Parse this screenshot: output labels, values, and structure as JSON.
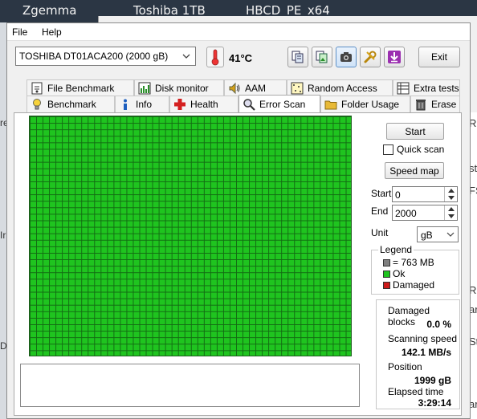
{
  "desktop": {
    "taskbar_items": [
      "Zgemma",
      "Toshiba 1TB",
      "HBCD_PE_x64"
    ],
    "right_edge_letters": [
      "R",
      "st",
      "FS",
      "R",
      "ar",
      "St",
      "ar"
    ],
    "left_edge_letters": [
      "re",
      "Ir",
      "D"
    ]
  },
  "menu": {
    "file": "File",
    "help": "Help"
  },
  "toolbar": {
    "drive": "TOSHIBA DT01ACA200 (2000 gB)",
    "temperature": "41°C",
    "exit_label": "Exit"
  },
  "tabs": {
    "row1": [
      "File Benchmark",
      "Disk monitor",
      "AAM",
      "Random Access",
      "Extra tests"
    ],
    "row2": [
      "Benchmark",
      "Info",
      "Health",
      "Error Scan",
      "Folder Usage",
      "Erase"
    ],
    "selected": "Error Scan"
  },
  "error_scan": {
    "start_button": "Start",
    "quick_scan_label": "Quick scan",
    "quick_scan_checked": false,
    "speed_map_button": "Speed map",
    "start_label": "Start",
    "start_value": "0",
    "end_label": "End",
    "end_value": "2000",
    "unit_label": "Unit",
    "unit_value": "gB",
    "legend_title": "Legend",
    "legend_block": "= 763 MB",
    "legend_ok": "Ok",
    "legend_damaged": "Damaged",
    "damaged_blocks_label": "Damaged blocks",
    "damaged_blocks_value": "0.0 %",
    "scanning_speed_label": "Scanning speed",
    "scanning_speed_value": "142.1 MB/s",
    "position_label": "Position",
    "position_value": "1999 gB",
    "elapsed_label": "Elapsed time",
    "elapsed_value": "3:29:14",
    "grid_state": "all-ok"
  },
  "colors": {
    "ok": "#1fc41f",
    "damaged": "#cc1a1a",
    "block": "#808080",
    "grid_line": "#136b13"
  }
}
